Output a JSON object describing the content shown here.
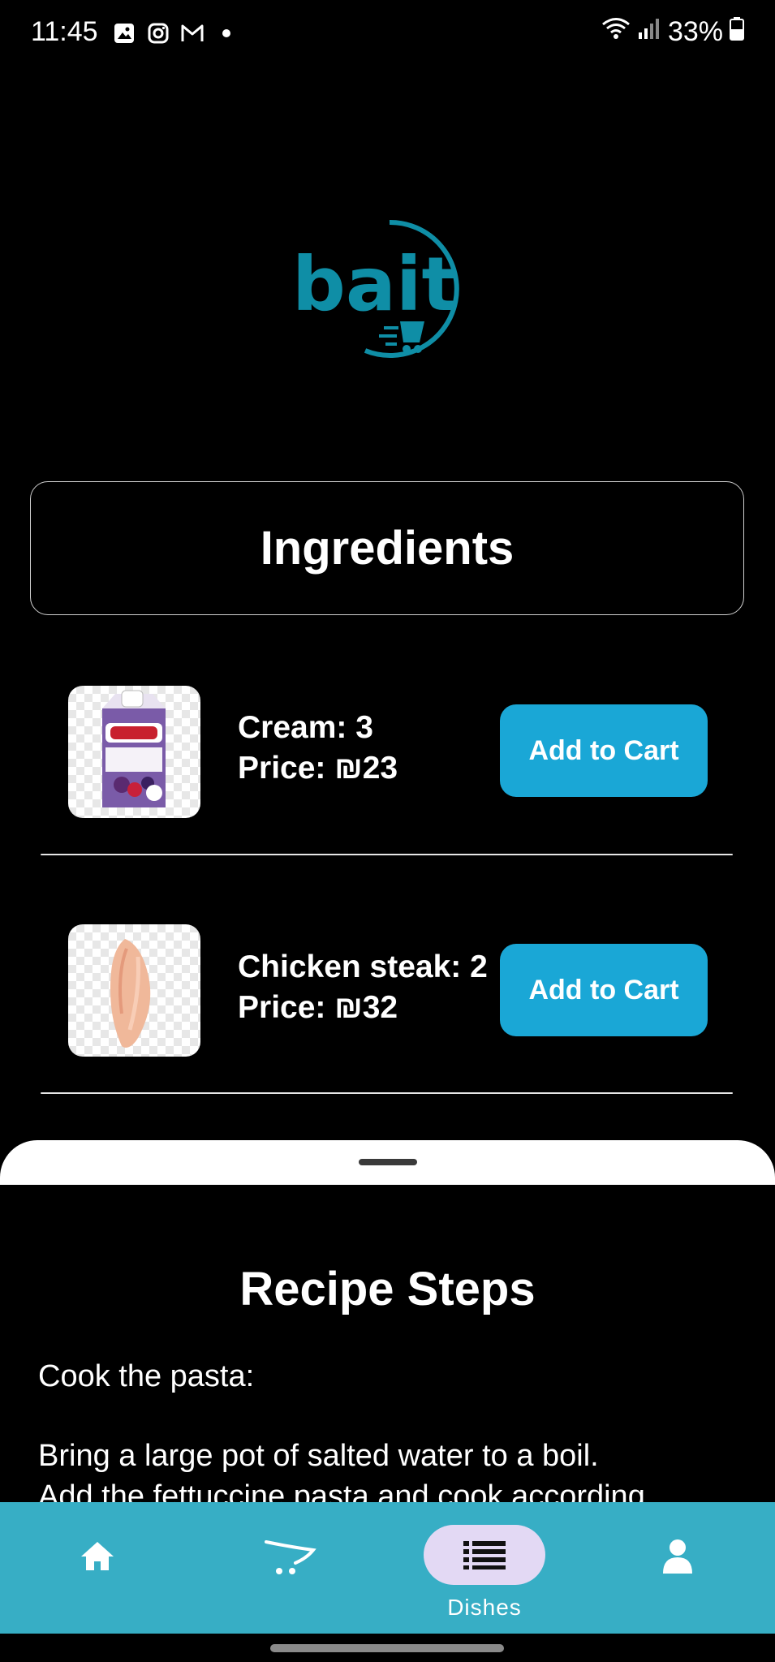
{
  "status_bar": {
    "time": "11:45",
    "battery": "33%",
    "icons": [
      "gallery-icon",
      "instagram-icon",
      "gmail-icon",
      "wifi-icon",
      "signal-icon",
      "battery-icon"
    ]
  },
  "logo": {
    "text": "bait",
    "color": "#0f8ea6"
  },
  "ingredients_header": "Ingredients",
  "ingredients": [
    {
      "name_line": "Cream: 3",
      "price_line": "Price: ₪23",
      "button": "Add to Cart",
      "image": "cream-carton"
    },
    {
      "name_line": "Chicken steak: 2",
      "price_line": "Price: ₪32",
      "button": "Add to Cart",
      "image": "chicken-breast"
    }
  ],
  "recipe": {
    "title": "Recipe Steps",
    "lines": [
      "Cook the pasta:",
      "Bring a large pot of salted water to a boil.",
      "Add the fettuccine pasta and cook according"
    ]
  },
  "bottom_nav": {
    "items": [
      {
        "icon": "home-icon"
      },
      {
        "icon": "cart-icon"
      },
      {
        "icon": "list-icon",
        "label": "Dishes",
        "selected": true
      },
      {
        "icon": "person-icon"
      }
    ]
  },
  "colors": {
    "accent": "#1aa7d6",
    "nav_bg": "#37aec5",
    "nav_selected": "#e3d9f4"
  }
}
